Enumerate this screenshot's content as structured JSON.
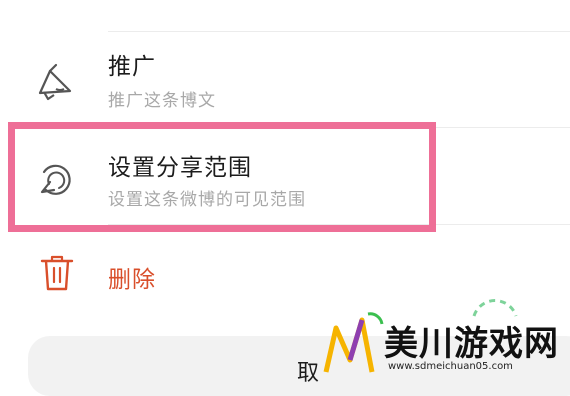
{
  "colors": {
    "highlight": "#ee6f97",
    "delete": "#d94f2b",
    "title": "#1c1c1c",
    "subtitle": "#a8a8a8"
  },
  "menu": {
    "items": [
      {
        "title": "推广",
        "subtitle": "推广这条博文",
        "icon": "megaphone-icon"
      },
      {
        "title": "设置分享范围",
        "subtitle": "设置这条微博的可见范围",
        "icon": "share-scope-icon"
      },
      {
        "title": "删除",
        "icon": "trash-icon"
      }
    ]
  },
  "cancel": {
    "label": "取"
  },
  "watermark": {
    "brand": "美川游戏网",
    "url": "www.sdmeichuan05.com"
  }
}
